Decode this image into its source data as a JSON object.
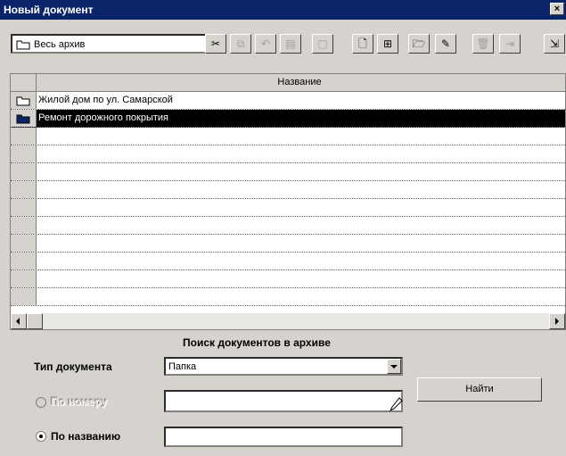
{
  "window": {
    "title": "Новый документ",
    "close": "×"
  },
  "toolbar": {
    "scope_value": "Весь архив",
    "buttons": [
      {
        "name": "cut-button",
        "glyph": "✂",
        "enabled": true
      },
      {
        "name": "copy-button",
        "glyph": "⧉",
        "enabled": false
      },
      {
        "name": "undo-button",
        "glyph": "↶",
        "enabled": false
      },
      {
        "name": "paste-button",
        "glyph": "▤",
        "enabled": false
      },
      {
        "name": "frame-button",
        "glyph": "▢",
        "enabled": false
      },
      {
        "name": "new-document-button",
        "glyph": "🗋",
        "enabled": true
      },
      {
        "name": "tree-button",
        "glyph": "⊞",
        "enabled": true
      },
      {
        "name": "open-folder-button",
        "glyph": "🗁",
        "enabled": true
      },
      {
        "name": "edit-button",
        "glyph": "✎",
        "enabled": true
      },
      {
        "name": "delete-button",
        "glyph": "🗑",
        "enabled": false
      },
      {
        "name": "move-button",
        "glyph": "⇥",
        "enabled": false
      },
      {
        "name": "exit-button",
        "glyph": "⇲",
        "enabled": true
      }
    ]
  },
  "table": {
    "header": "Название",
    "rows": [
      {
        "text": "Жилой дом по ул. Самарской",
        "icon": "folder-icon",
        "selected": false
      },
      {
        "text": "Ремонт дорожного покрытия",
        "icon": "folder-icon",
        "selected": true
      },
      {
        "text": ""
      },
      {
        "text": ""
      },
      {
        "text": ""
      },
      {
        "text": ""
      },
      {
        "text": ""
      },
      {
        "text": ""
      },
      {
        "text": ""
      },
      {
        "text": ""
      },
      {
        "text": ""
      },
      {
        "text": ""
      }
    ]
  },
  "search": {
    "title": "Поиск документов в архиве",
    "doc_type_label": "Тип документа",
    "doc_type_value": "Папка",
    "by_number_label": "По номеру",
    "by_number_value": "",
    "by_name_label": "По названию",
    "by_name_value": "",
    "find_button": "Найти",
    "mode": "by_name"
  },
  "colors": {
    "titlebar": "#0a246a",
    "face": "#d6d3ce",
    "selection": "#000000"
  }
}
